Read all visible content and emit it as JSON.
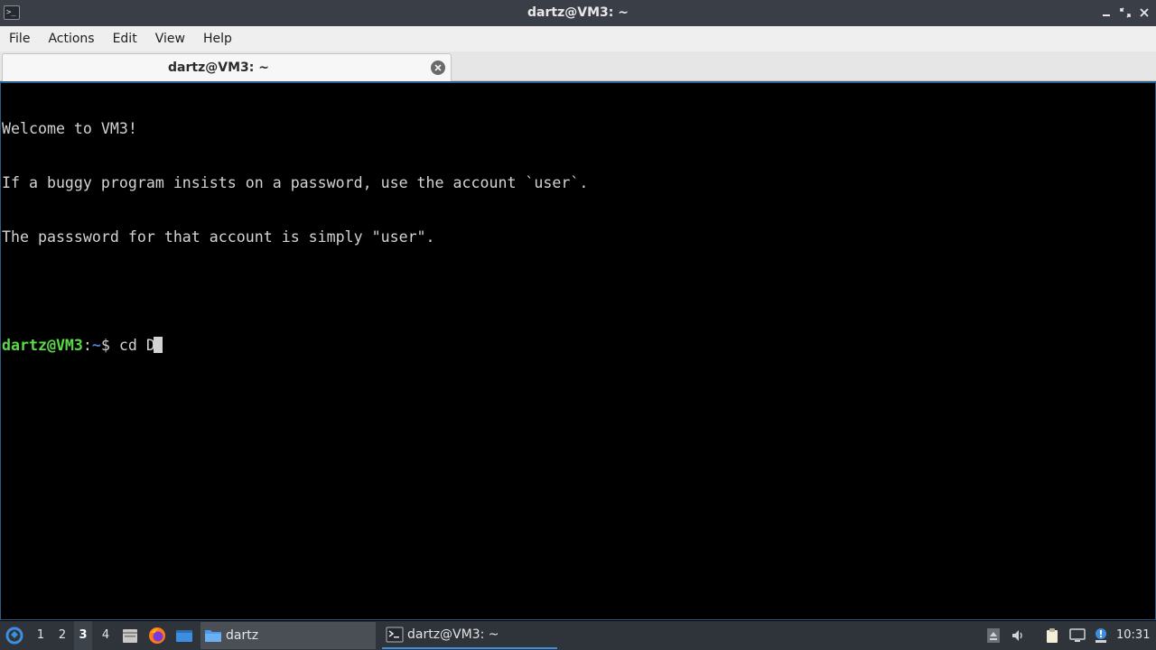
{
  "window": {
    "title": "dartz@VM3: ~"
  },
  "menubar": {
    "items": [
      "File",
      "Actions",
      "Edit",
      "View",
      "Help"
    ]
  },
  "tabs": [
    {
      "label": "dartz@VM3: ~",
      "active": true
    }
  ],
  "terminal": {
    "lines": [
      "Welcome to VM3!",
      "If a buggy program insists on a password, use the account `user`.",
      "The passsword for that account is simply \"user\".",
      ""
    ],
    "prompt": {
      "user_host": "dartz@VM3",
      "separator": ":",
      "path": "~",
      "symbol": "$",
      "command": "cd D"
    },
    "colors": {
      "fg": "#d3d3d3",
      "user": "#5bd948",
      "path": "#4d7fd1",
      "bg": "#000000"
    }
  },
  "taskbar": {
    "desktops": [
      "1",
      "2",
      "3",
      "4"
    ],
    "active_desktop": "3",
    "launchers": [
      "file-manager-icon",
      "firefox-icon",
      "show-desktop-icon"
    ],
    "tasks": [
      {
        "label": "dartz",
        "icon": "folder-icon"
      },
      {
        "label": "dartz@VM3: ~",
        "icon": "terminal-icon"
      }
    ],
    "tray": [
      "removable-media-icon",
      "volume-icon",
      "clipboard-icon",
      "network-icon",
      "update-notifier-icon"
    ],
    "clock": "10:31"
  }
}
